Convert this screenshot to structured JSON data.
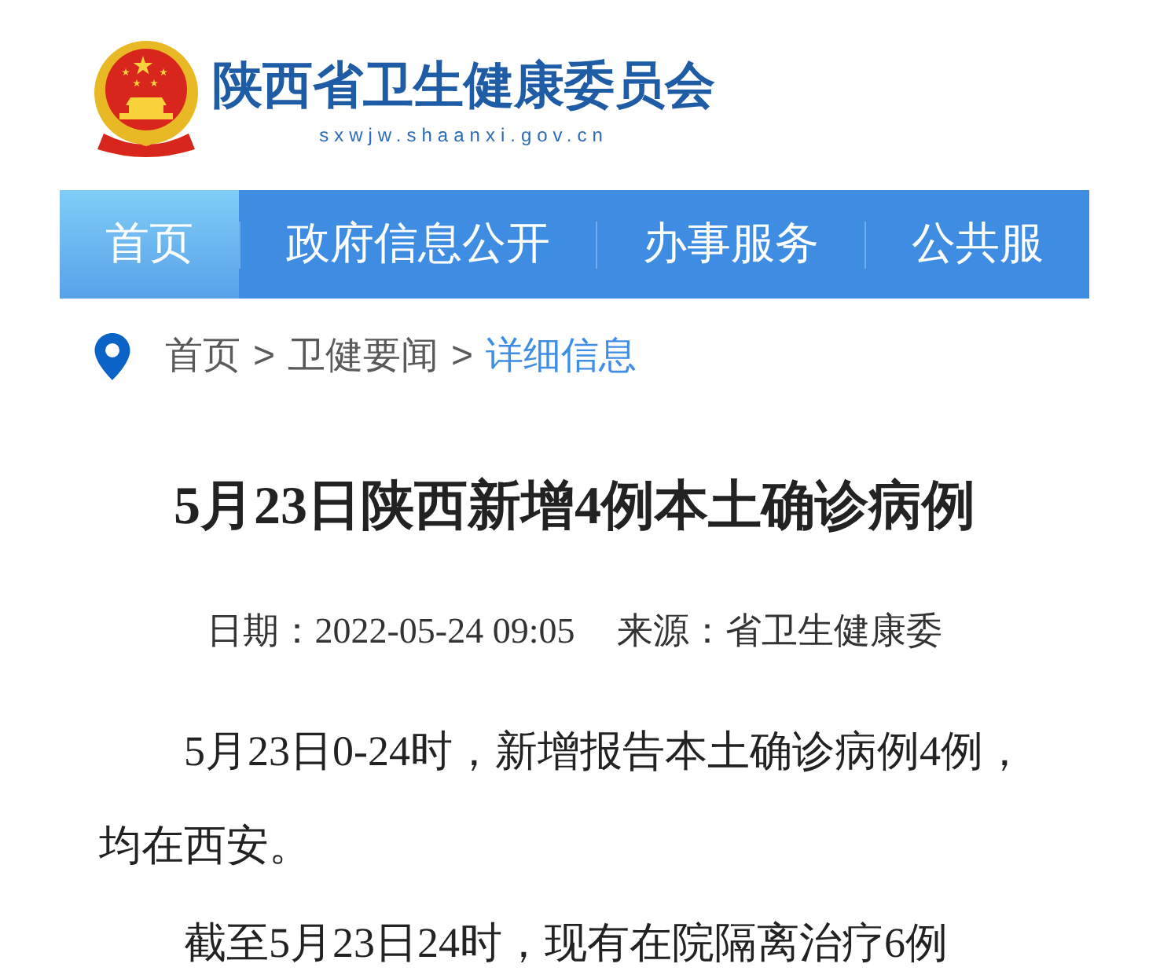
{
  "header": {
    "title": "陕西省卫生健康委员会",
    "url": "sxwjw.shaanxi.gov.cn"
  },
  "nav": [
    {
      "label": "首页",
      "selected": true
    },
    {
      "label": "政府信息公开",
      "selected": false
    },
    {
      "label": "办事服务",
      "selected": false
    },
    {
      "label": "公共服",
      "selected": false
    }
  ],
  "breadcrumb": [
    {
      "kind": "link",
      "text": "首页"
    },
    {
      "kind": "separator",
      "text": ">"
    },
    {
      "kind": "link",
      "text": "卫健要闻"
    },
    {
      "kind": "separator",
      "text": ">"
    },
    {
      "kind": "current",
      "text": "详细信息"
    }
  ],
  "article": {
    "title": "5月23日陕西新增4例本土确诊病例",
    "date": "日期：2022-05-24 09:05",
    "source": "来源：省卫生健康委",
    "paragraphs": [
      "5月23日0-24时，新增报告本土确诊病例4例，均在西安。",
      "截至5月23日24时，现有在院隔离治疗6例"
    ]
  }
}
